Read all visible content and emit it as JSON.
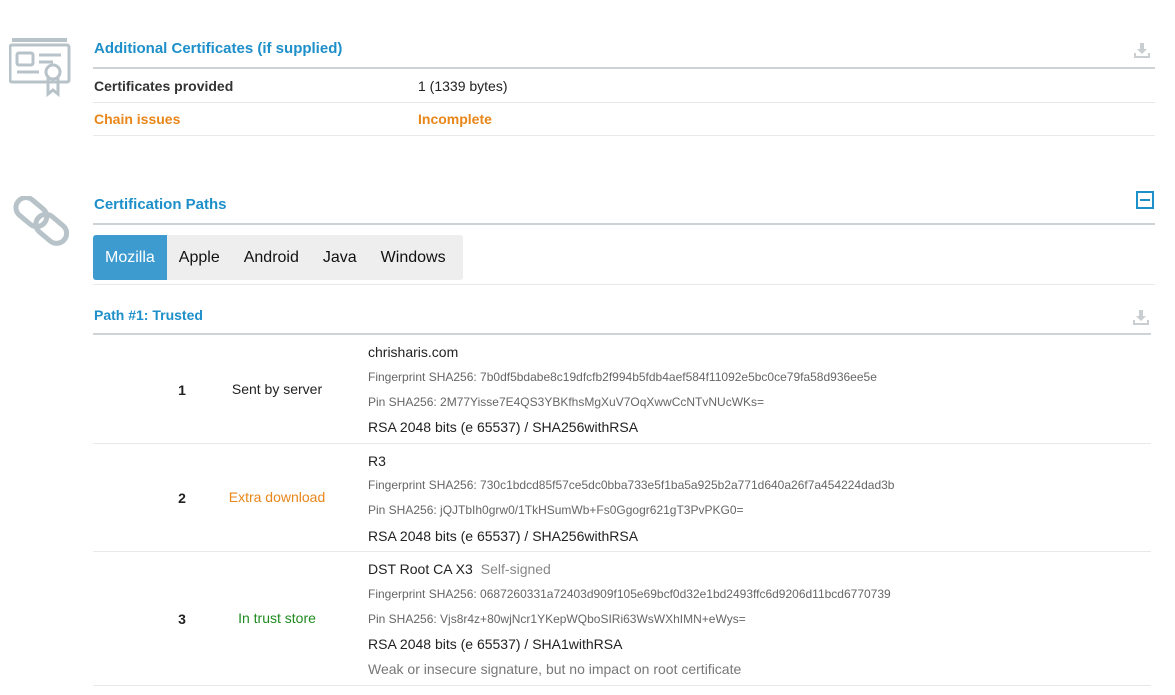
{
  "additional": {
    "title": "Additional Certificates (if supplied)",
    "rows": [
      {
        "label": "Certificates provided",
        "value": "1 (1339 bytes)"
      },
      {
        "label": "Chain issues",
        "value": "Incomplete"
      }
    ]
  },
  "paths": {
    "title": "Certification Paths",
    "tabs": [
      "Mozilla",
      "Apple",
      "Android",
      "Java",
      "Windows"
    ],
    "active_tab": "Mozilla",
    "path_title": "Path #1: Trusted",
    "certs": [
      {
        "num": "1",
        "status": "Sent by server",
        "name": "chrisharis.com",
        "fingerprint": "Fingerprint SHA256: 7b0df5bdabe8c19dfcfb2f994b5fdb4aef584f11092e5bc0ce79fa58d936ee5e",
        "pin": "Pin SHA256: 2M77Yisse7E4QS3YBKfhsMgXuV7OqXwwCcNTvNUcWKs=",
        "key": "RSA 2048 bits (e 65537) / SHA256withRSA"
      },
      {
        "num": "2",
        "status": "Extra download",
        "name": "R3",
        "fingerprint": "Fingerprint SHA256: 730c1bdcd85f57ce5dc0bba733e5f1ba5a925b2a771d640a26f7a454224dad3b",
        "pin": "Pin SHA256: jQJTbIh0grw0/1TkHSumWb+Fs0Ggogr621gT3PvPKG0=",
        "key": "RSA 2048 bits (e 65537) / SHA256withRSA"
      },
      {
        "num": "3",
        "status": "In trust store",
        "name": "DST Root CA X3",
        "self_signed": "Self-signed",
        "fingerprint": "Fingerprint SHA256: 0687260331a72403d909f105e69bcf0d32e1bd2493ffc6d9206d11bcd6770739",
        "pin": "Pin SHA256: Vjs8r4z+80wjNcr1YKepWQboSIRi63WsWXhIMN+eWys=",
        "key": "RSA 2048 bits (e 65537) / SHA1withRSA",
        "note": "Weak or insecure signature, but no impact on root certificate"
      }
    ]
  },
  "colors": {
    "accent": "#1d8fc9",
    "tab_active": "#3d9bd0",
    "warning": "#e8861a",
    "trusted": "#1f8b1f"
  },
  "icons": [
    "certificate-icon",
    "download-icon",
    "chain-link-icon",
    "collapse-icon"
  ]
}
